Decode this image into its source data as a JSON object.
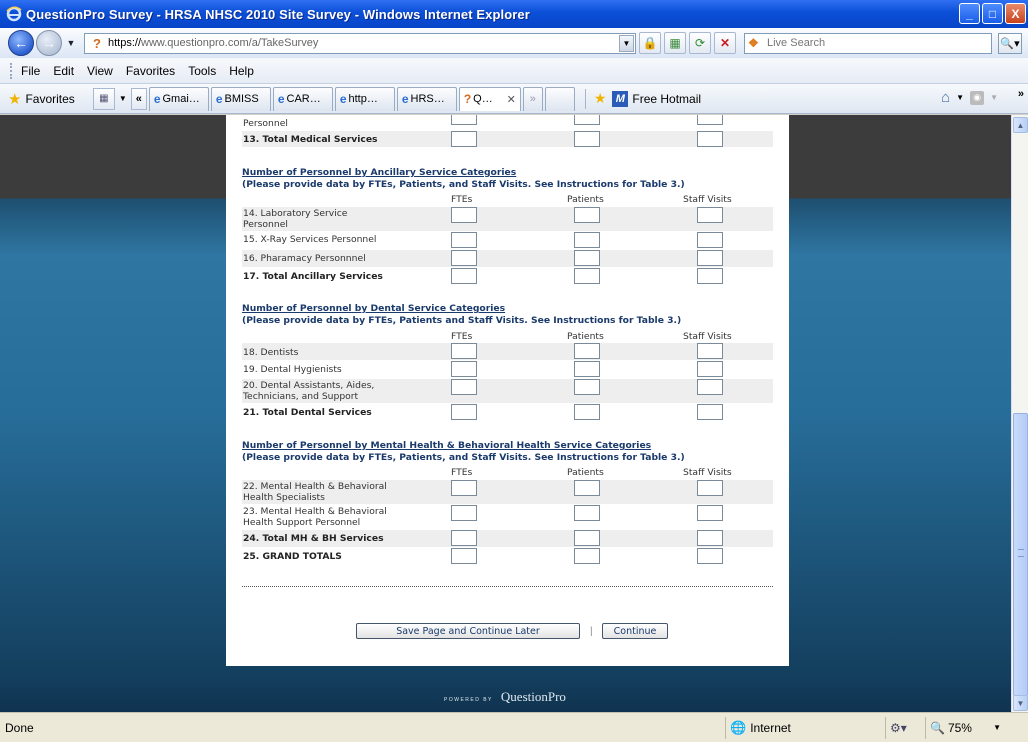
{
  "window": {
    "title": "QuestionPro Survey - HRSA NHSC 2010 Site Survey - Windows Internet Explorer",
    "controls": {
      "minimize": "_",
      "maximize": "□",
      "close": "X"
    }
  },
  "address": {
    "url_scheme": "https://",
    "url_host": "www.questionpro.com",
    "url_path": "/a/TakeSurvey",
    "search_placeholder": "Live Search"
  },
  "menu": {
    "items": [
      "File",
      "Edit",
      "View",
      "Favorites",
      "Tools",
      "Help"
    ]
  },
  "favorites": {
    "label": "Favorites",
    "tabs": [
      "Gmai…",
      "BMISS",
      "CAR…",
      "http…",
      "HRS…",
      "Q…"
    ],
    "hotmail": "Free Hotmail"
  },
  "survey": {
    "partial_row_label": "Personnel",
    "total_medical": "13. Total Medical Services",
    "columns": {
      "ftes": "FTEs",
      "patients": "Patients",
      "visits": "Staff Visits"
    },
    "sections": [
      {
        "title": "Number of Personnel by Ancillary Service Categories",
        "subtitle": "(Please provide data by FTEs, Patients, and Staff Visits. See Instructions for Table 3.)",
        "rows": [
          {
            "label": "14. Laboratory Service Personnel",
            "bold": false
          },
          {
            "label": "15. X-Ray Services Personnel",
            "bold": false
          },
          {
            "label": "16. Pharamacy Personnnel",
            "bold": false
          },
          {
            "label": "17. Total Ancillary Services",
            "bold": true
          }
        ]
      },
      {
        "title": "Number of Personnel by Dental Service Categories",
        "subtitle": "(Please provide data by FTEs, Patients and Staff Visits. See Instructions for Table 3.)",
        "rows": [
          {
            "label": "18. Dentists",
            "bold": false
          },
          {
            "label": "19. Dental Hygienists",
            "bold": false
          },
          {
            "label": "20. Dental Assistants, Aides, Technicians, and Support",
            "bold": false
          },
          {
            "label": "21. Total Dental Services",
            "bold": true
          }
        ]
      },
      {
        "title": "Number of Personnel by Mental Health & Behavioral Health Service Categories",
        "subtitle": "(Please provide data by FTEs, Patients, and Staff Visits. See Instructions for Table 3.)",
        "rows": [
          {
            "label": "22. Mental Health & Behavioral Health Specialists",
            "bold": false
          },
          {
            "label": "23. Mental Health & Behavioral Health Support Personnel",
            "bold": false
          },
          {
            "label": "24. Total MH & BH Services",
            "bold": true
          },
          {
            "label": "25. GRAND TOTALS",
            "bold": true
          }
        ]
      }
    ],
    "buttons": {
      "save": "Save Page and Continue Later",
      "continue": "Continue",
      "separator": "|"
    },
    "powered_small": "POWERED BY",
    "powered_brand": "QuestionPro"
  },
  "status": {
    "text": "Done",
    "zone": "Internet",
    "zoom": "75%"
  }
}
